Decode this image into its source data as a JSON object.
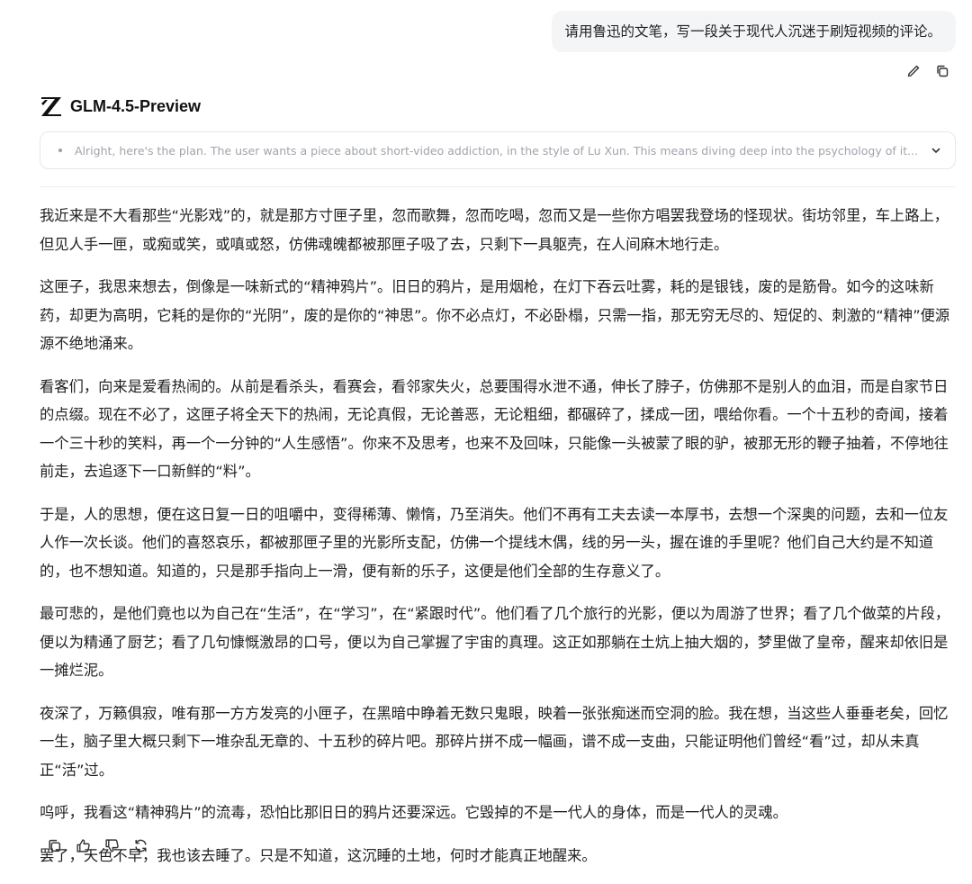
{
  "user_message": "请用鲁迅的文笔，写一段关于现代人沉迷于刷短视频的评论。",
  "user_actions": {
    "edit_icon": "pencil-icon",
    "copy_icon": "copy-icon"
  },
  "model": {
    "name": "GLM-4.5-Preview",
    "logo_icon": "z-logo-icon"
  },
  "thinking": {
    "summary": "Alright, here's the plan. The user wants a piece about short-video addiction, in the style of Lu Xun. This means diving deep into the psychology of it...",
    "expand_icon": "chevron-down-icon"
  },
  "answer": {
    "paragraphs": [
      "我近来是不大看那些“光影戏”的，就是那方寸匣子里，忽而歌舞，忽而吃喝，忽而又是一些你方唱罢我登场的怪现状。街坊邻里，车上路上，但见人手一匣，或痴或笑，或嗔或怒，仿佛魂魄都被那匣子吸了去，只剩下一具躯壳，在人间麻木地行走。",
      "这匣子，我思来想去，倒像是一味新式的“精神鸦片”。旧日的鸦片，是用烟枪，在灯下吞云吐雾，耗的是银钱，废的是筋骨。如今的这味新药，却更为高明，它耗的是你的“光阴”，废的是你的“神思”。你不必点灯，不必卧榻，只需一指，那无穷无尽的、短促的、刺激的“精神”便源源不绝地涌来。",
      "看客们，向来是爱看热闹的。从前是看杀头，看赛会，看邻家失火，总要围得水泄不通，伸长了脖子，仿佛那不是别人的血泪，而是自家节日的点缀。现在不必了，这匣子将全天下的热闹，无论真假，无论善恶，无论粗细，都碾碎了，揉成一团，喂给你看。一个十五秒的奇闻，接着一个三十秒的笑料，再一个一分钟的“人生感悟”。你来不及思考，也来不及回味，只能像一头被蒙了眼的驴，被那无形的鞭子抽着，不停地往前走，去追逐下一口新鲜的“料”。",
      "于是，人的思想，便在这日复一日的咀嚼中，变得稀薄、懒惰，乃至消失。他们不再有工夫去读一本厚书，去想一个深奥的问题，去和一位友人作一次长谈。他们的喜怒哀乐，都被那匣子里的光影所支配，仿佛一个提线木偶，线的另一头，握在谁的手里呢？他们自己大约是不知道的，也不想知道。知道的，只是那手指向上一滑，便有新的乐子，这便是他们全部的生存意义了。",
      "最可悲的，是他们竟也以为自己在“生活”，在“学习”，在“紧跟时代”。他们看了几个旅行的光影，便以为周游了世界；看了几个做菜的片段，便以为精通了厨艺；看了几句慷慨激昂的口号，便以为自己掌握了宇宙的真理。这正如那躺在土炕上抽大烟的，梦里做了皇帝，醒来却依旧是一摊烂泥。",
      "夜深了，万籁俱寂，唯有那一方方发亮的小匣子，在黑暗中睁着无数只鬼眼，映着一张张痴迷而空洞的脸。我在想，当这些人垂垂老矣，回忆一生，脑子里大概只剩下一堆杂乱无章的、十五秒的碎片吧。那碎片拼不成一幅画，谱不成一支曲，只能证明他们曾经“看”过，却从未真正“活”过。",
      "呜呼，我看这“精神鸦片”的流毒，恐怕比那旧日的鸦片还要深远。它毁掉的不是一代人的身体，而是一代人的灵魂。",
      "罢了，天色不早，我也该去睡了。只是不知道，这沉睡的土地，何时才能真正地醒来。"
    ]
  },
  "footer_actions": [
    "copy-icon",
    "thumbs-up-icon",
    "thumbs-down-icon",
    "regenerate-icon"
  ]
}
